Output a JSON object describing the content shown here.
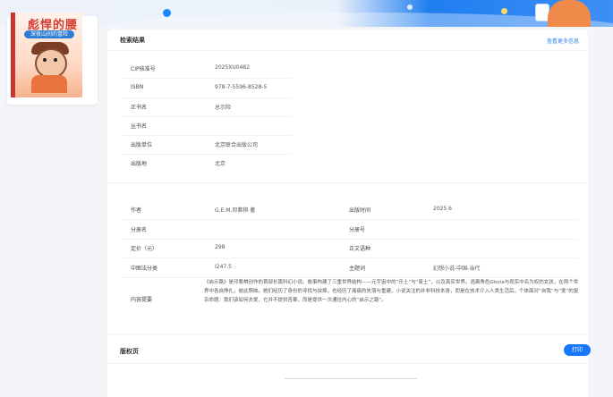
{
  "cover": {
    "title": "彪悍的腰",
    "subtitle": "深夜山间的冒险",
    "colors": {
      "accent": "#d23b2f",
      "badge": "#2e7bd6"
    }
  },
  "header": {
    "title": "检索结果",
    "more_link": "查看更多信息"
  },
  "basic_info": [
    {
      "label": "CIP核准号",
      "value": "2025XU0482"
    },
    {
      "label": "ISBN",
      "value": "978-7-5596-8528-5"
    },
    {
      "label": "正书名",
      "value": "总示险"
    },
    {
      "label": "丛书名",
      "value": ""
    },
    {
      "label": "出版单位",
      "value": "北京联合出版公司"
    },
    {
      "label": "出版地",
      "value": "北京"
    }
  ],
  "detail_left": [
    {
      "label": "作者",
      "value": "G.E.M.邓紫棋 著"
    },
    {
      "label": "分册名",
      "value": ""
    },
    {
      "label": "定价（元）",
      "value": "298"
    },
    {
      "label": "中图法分类",
      "value": "I247.5"
    }
  ],
  "detail_right": [
    {
      "label": "出版时间",
      "value": "2025.6"
    },
    {
      "label": "分册号",
      "value": ""
    },
    {
      "label": "正文语种",
      "value": ""
    },
    {
      "label": "主题词",
      "value": "幻想小说-中国-当代"
    }
  ],
  "summary": {
    "label": "内容提要",
    "text": "《启示路》是邓紫棋创作的首部长篇科幻小说。故事构建了三重世界结构——元宇宙中的“乐土”与“废土”，以及真实世界。逃离角色Gloria与现实中名为权的女孩，在两个世界中各自挣扎，彼此照映。她们经历了身份的寻找与抉择，也经历了痛痛的失落与重建。小说关注的并非科技本身，而是在技术介入人类生活后，个体面对“自我”与“爱”的复杂命题：我们该如何去爱、它并不提供答案，而是提供一次通往内心的“启示之路”。"
  },
  "section2": {
    "title": "版权页",
    "button": "打印"
  }
}
